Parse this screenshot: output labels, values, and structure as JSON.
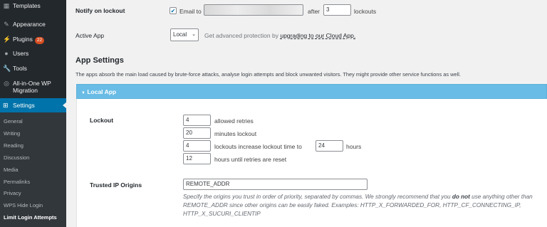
{
  "sidebar": {
    "items": [
      {
        "label": "Templates",
        "icon": "templates-icon"
      },
      {
        "label": "Appearance",
        "icon": "appearance-icon"
      },
      {
        "label": "Plugins",
        "icon": "plugins-icon",
        "badge": "22"
      },
      {
        "label": "Users",
        "icon": "users-icon"
      },
      {
        "label": "Tools",
        "icon": "tools-icon"
      },
      {
        "label": "All-in-One WP Migration",
        "icon": "migration-icon"
      },
      {
        "label": "Settings",
        "icon": "settings-icon"
      }
    ],
    "submenu": [
      "General",
      "Writing",
      "Reading",
      "Discussion",
      "Media",
      "Permalinks",
      "Privacy",
      "WPS Hide Login",
      "Limit Login Attempts"
    ]
  },
  "notify": {
    "label": "Notify on lockout",
    "checkbox_label": "Email to",
    "email_value": "",
    "after_label": "after",
    "after_value": "3",
    "lockouts_label": "lockouts"
  },
  "active_app": {
    "label": "Active App",
    "select_value": "Local",
    "text_prefix": "Get advanced protection by",
    "link_text": "upgrading to our Cloud App."
  },
  "app_settings": {
    "title": "App Settings",
    "description": "The apps absorb the main load caused by brute-force attacks, analyse login attempts and block unwanted visitors. They might provide other service functions as well."
  },
  "local_app": {
    "header": "Local App",
    "lockout": {
      "label": "Lockout",
      "allowed_retries_value": "4",
      "allowed_retries_label": "allowed retries",
      "minutes_value": "20",
      "minutes_label": "minutes lockout",
      "increase_value": "4",
      "increase_label": "lockouts increase lockout time to",
      "hours_value": "24",
      "hours_label": "hours",
      "reset_value": "12",
      "reset_label": "hours until retries are reset"
    },
    "trusted": {
      "label": "Trusted IP Origins",
      "value": "REMOTE_ADDR",
      "desc_part1": "Specify the origins you trust in order of priority, separated by commas. We strongly recommend that you ",
      "desc_bold": "do not",
      "desc_part2": " use anything other than REMOTE_ADDR since other origins can be easily faked. Examples: HTTP_X_FORWARDED_FOR, HTTP_CF_CONNECTING_IP, HTTP_X_SUCURI_CLIENTIP"
    }
  }
}
